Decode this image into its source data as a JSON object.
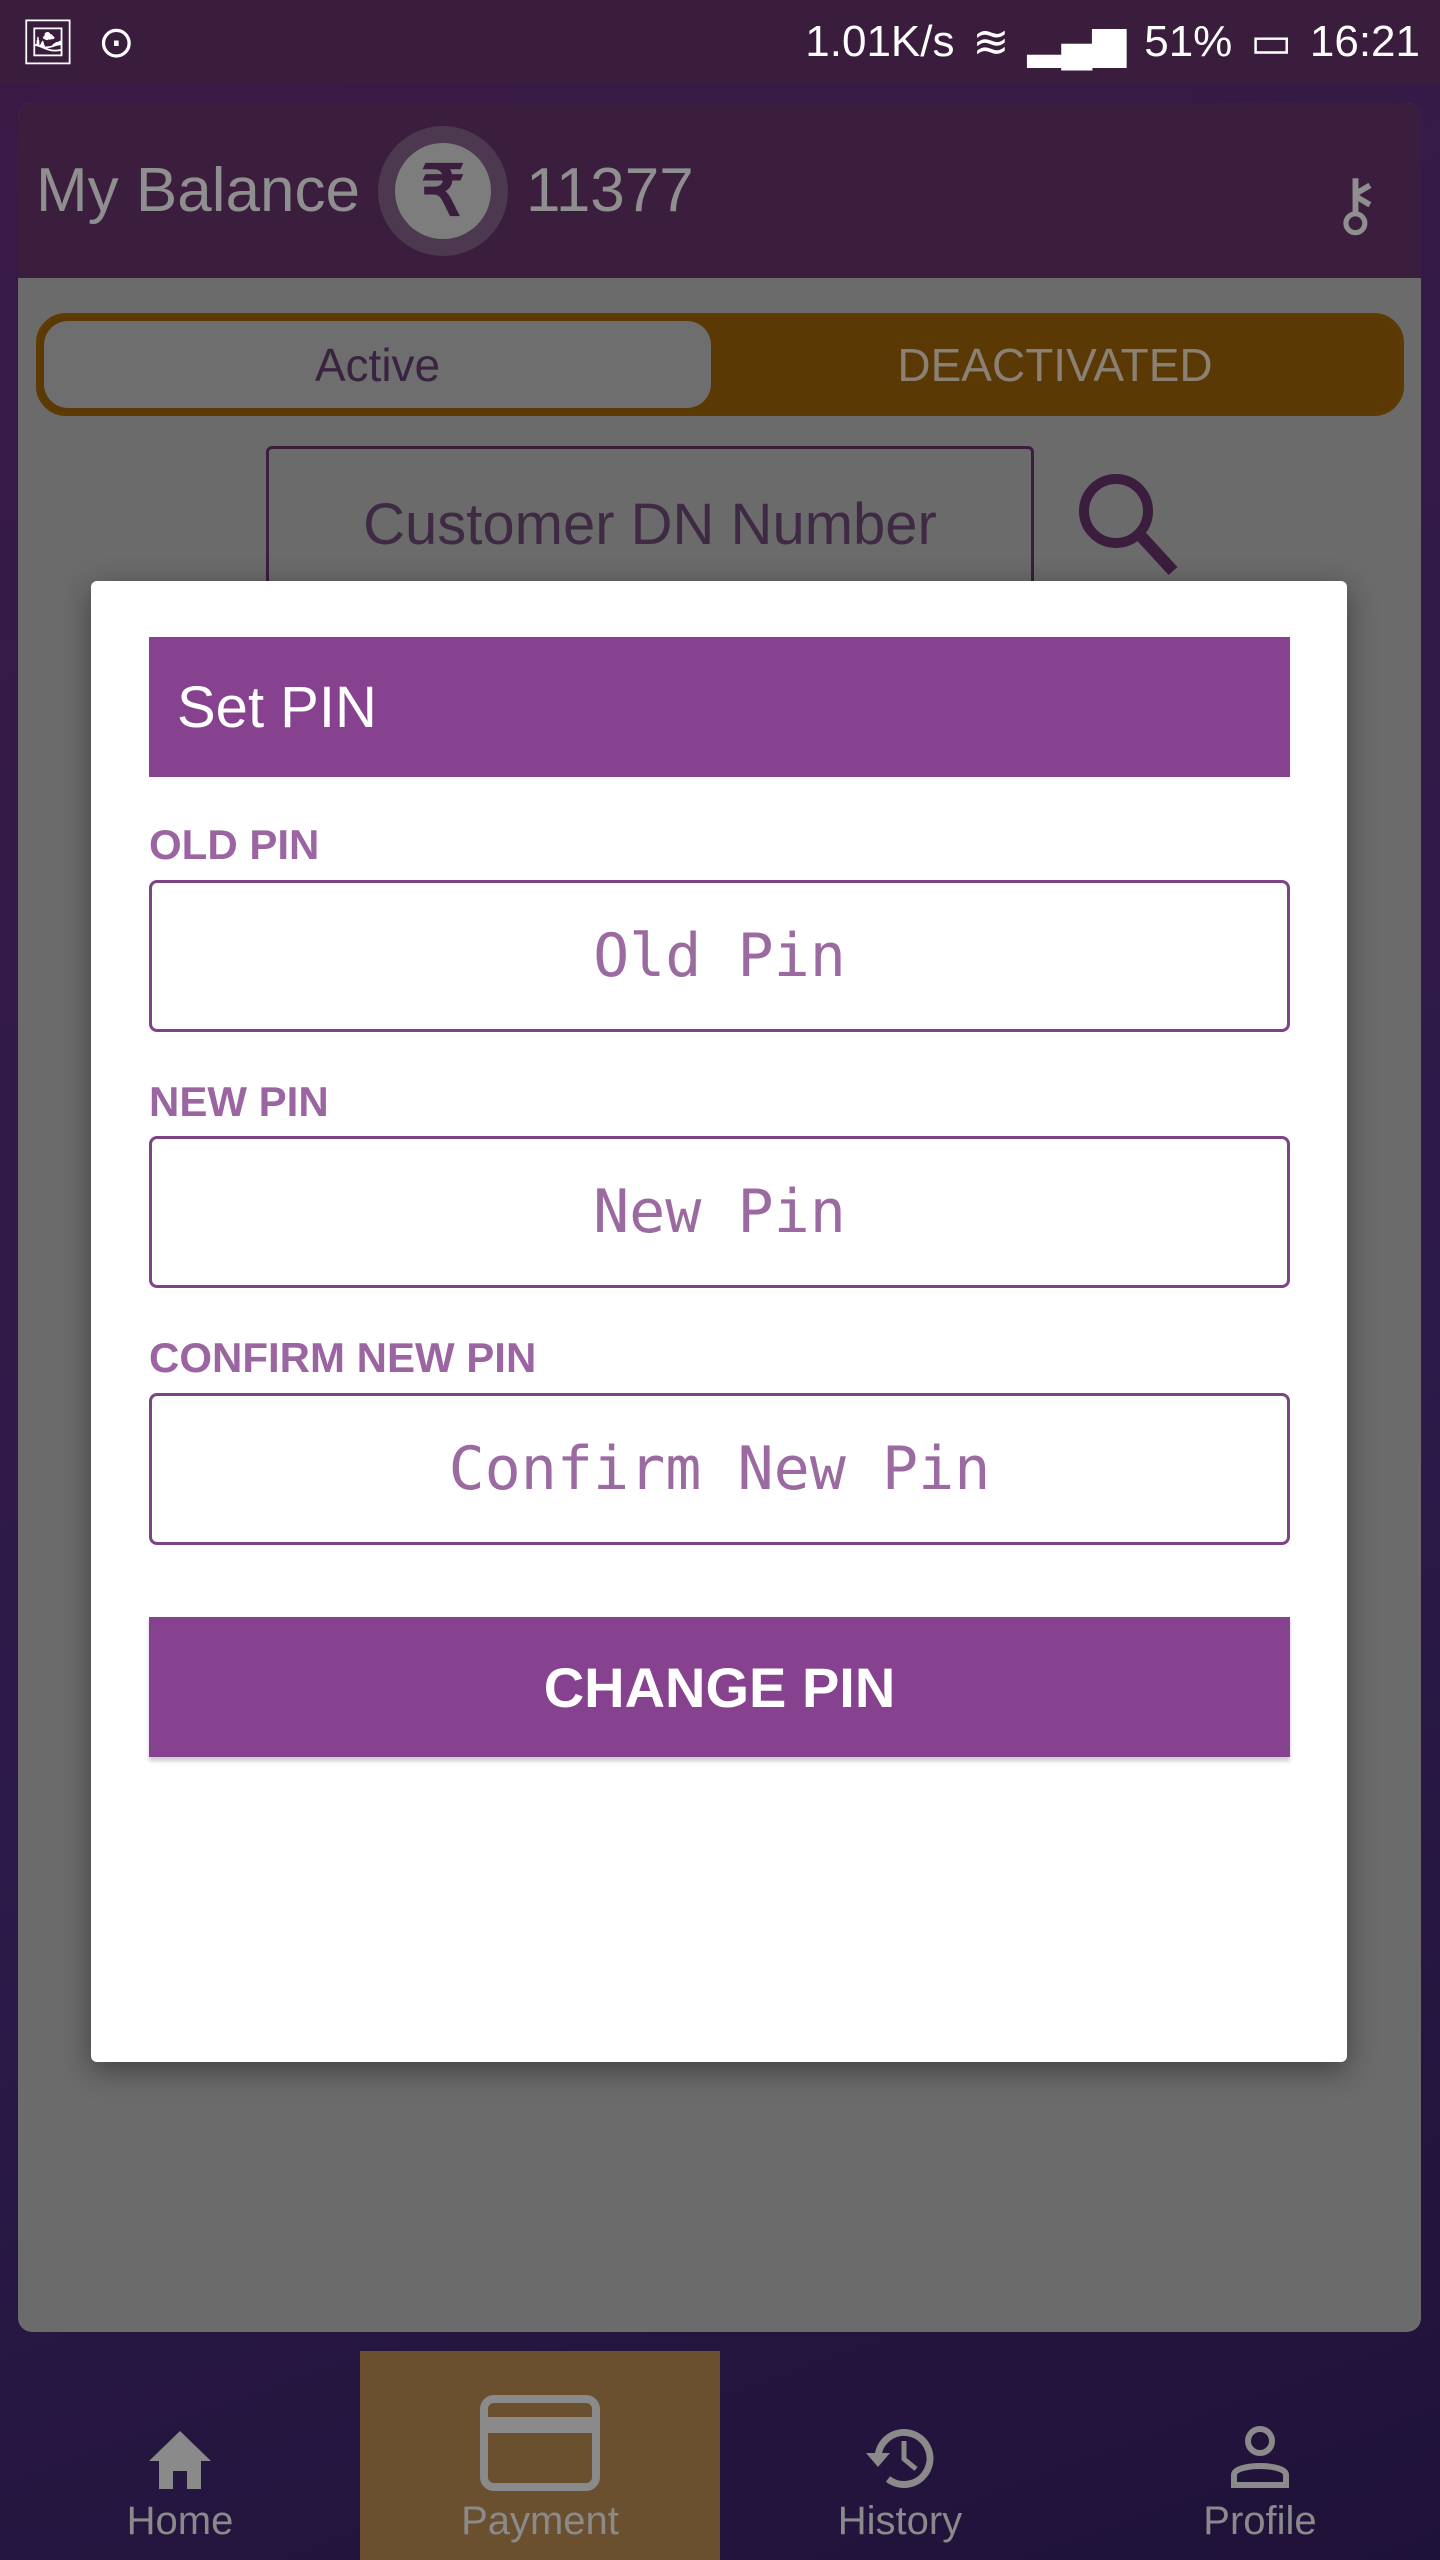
{
  "status_bar": {
    "speed": "1.01K/s",
    "battery": "51%",
    "time": "16:21",
    "icons": [
      "image-icon",
      "message-icon",
      "wifi-icon",
      "signal-1-icon",
      "signal-2-icon",
      "battery-icon"
    ]
  },
  "header": {
    "title": "My Balance",
    "currency_icon": "rupee-icon",
    "balance": "11377",
    "key_icon": "key-icon"
  },
  "toggle": {
    "active": "Active",
    "deactivated": "DEACTIVATED"
  },
  "search": {
    "placeholder": "Customer DN Number",
    "icon": "search-icon"
  },
  "dialog": {
    "title": "Set PIN",
    "fields": [
      {
        "label": "OLD PIN",
        "placeholder": "Old Pin"
      },
      {
        "label": "NEW PIN",
        "placeholder": "New Pin"
      },
      {
        "label": "CONFIRM NEW PIN",
        "placeholder": "Confirm New Pin"
      }
    ],
    "button": "CHANGE PIN"
  },
  "nav": [
    {
      "label": "Home",
      "icon": "home-icon"
    },
    {
      "label": "Payment",
      "icon": "card-icon",
      "selected": true
    },
    {
      "label": "History",
      "icon": "history-icon"
    },
    {
      "label": "Profile",
      "icon": "person-icon"
    }
  ],
  "colors": {
    "primary": "#87428f",
    "label": "#9a65a1",
    "status_bar": "#3a1c3d"
  }
}
